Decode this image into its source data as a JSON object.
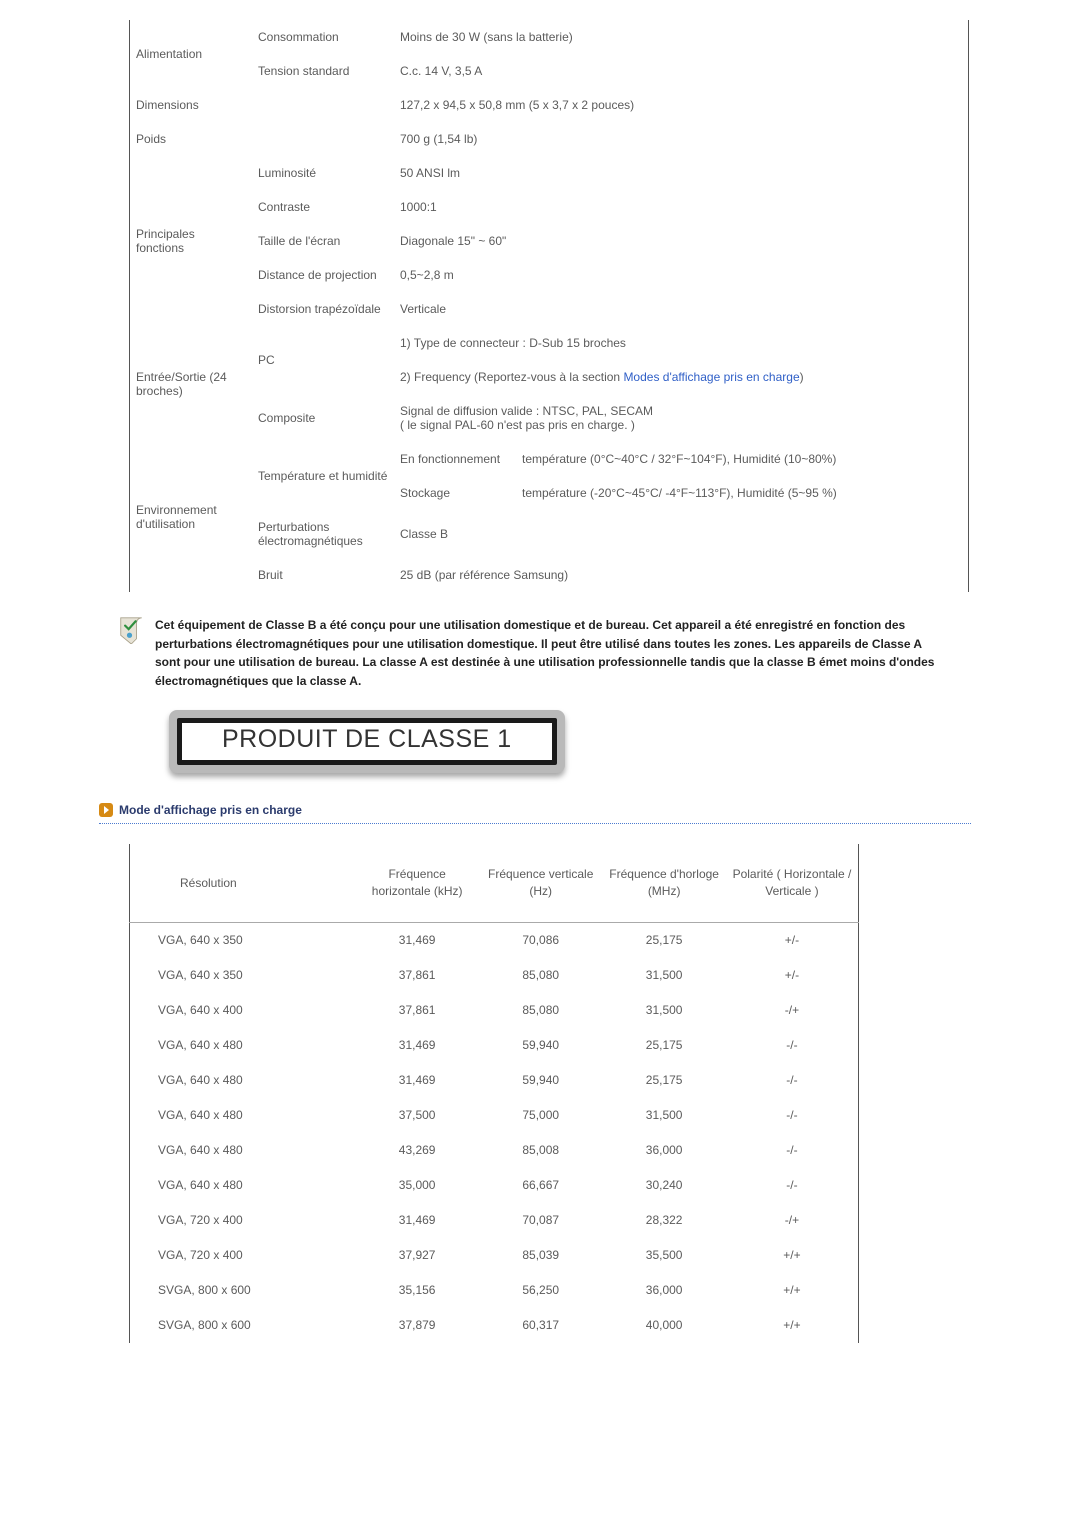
{
  "spec": {
    "rows": [
      {
        "c1": "Alimentation",
        "c1_rowspan": 2,
        "c2": "Consommation",
        "val": "Moins de 30  W (sans la batterie)"
      },
      {
        "c2": "Tension standard",
        "val": "C.c. 14 V, 3,5 A"
      },
      {
        "c1": "Dimensions",
        "c2": "",
        "val": "127,2 x 94,5 x 50,8 mm (5 x 3,7 x 2 pouces)"
      },
      {
        "c1": "Poids",
        "c2": "",
        "val": "700 g (1,54 lb)"
      },
      {
        "c1": "Principales fonctions",
        "c1_rowspan": 5,
        "c2": "Luminosité",
        "val": "50 ANSI lm"
      },
      {
        "c2": "Contraste",
        "val": "1000:1"
      },
      {
        "c2": "Taille de l'écran",
        "val": "Diagonale 15\" ~ 60\""
      },
      {
        "c2": "Distance de projection",
        "val": "0,5~2,8 m"
      },
      {
        "c2": "Distorsion trapézoïdale",
        "val": "Verticale"
      },
      {
        "c1": "Entrée/Sortie (24 broches)",
        "c1_rowspan": 3,
        "c2": "PC",
        "c2_rowspan": 2,
        "val": "1) Type de connecteur : D-Sub 15 broches"
      },
      {
        "val_prefix": "2) Frequency (Reportez-vous à la section ",
        "link": "Modes d'affichage pris en charge",
        "val_suffix": ")"
      },
      {
        "c2": "Composite",
        "val": "Signal de diffusion valide : NTSC, PAL, SECAM\n( le signal PAL-60 n'est pas pris en charge. )"
      },
      {
        "c1": "Environnement d'utilisation",
        "c1_rowspan": 4,
        "c2": "Température et humidité",
        "c2_rowspan": 2,
        "sub1": "En fonctionnement",
        "sub2": "température (0°C~40°C / 32°F~104°F), Humidité (10~80%)"
      },
      {
        "sub1": "Stockage",
        "sub2": "température (-20°C~45°C/ -4°F~113°F), Humidité (5~95 %)"
      },
      {
        "c2": "Perturbations électromagnétiques",
        "val": "Classe B"
      },
      {
        "c2": "Bruit",
        "val": "25 dB (par référence Samsung)"
      }
    ]
  },
  "note": "Cet équipement de Classe B a été conçu pour une utilisation domestique et de bureau. Cet appareil a été enregistré en fonction des perturbations électromagnétiques pour une utilisation domestique. Il peut être utilisé dans toutes les zones. Les appareils de Classe A sont pour une utilisation de bureau. La classe A est destinée à une utilisation professionnelle tandis que la classe B émet moins d'ondes électromagnétiques que la classe A.",
  "plate": "PRODUIT DE CLASSE 1",
  "modes_title": "Mode d'affichage pris en charge",
  "modes_headers": {
    "res": "Résolution",
    "h": "Fréquence horizontale (kHz)",
    "v": "Fréquence verticale (Hz)",
    "clk": "Fréquence d'horloge (MHz)",
    "pol": "Polarité ( Horizontale / Verticale )"
  },
  "chart_data": {
    "type": "table",
    "columns": [
      "Résolution",
      "Fréquence horizontale (kHz)",
      "Fréquence verticale (Hz)",
      "Fréquence d'horloge (MHz)",
      "Polarité ( Horizontale / Verticale )"
    ],
    "rows": [
      [
        "VGA, 640 x 350",
        "31,469",
        "70,086",
        "25,175",
        "+/-"
      ],
      [
        "VGA, 640 x 350",
        "37,861",
        "85,080",
        "31,500",
        "+/-"
      ],
      [
        "VGA, 640 x 400",
        "37,861",
        "85,080",
        "31,500",
        "-/+"
      ],
      [
        "VGA, 640 x 480",
        "31,469",
        "59,940",
        "25,175",
        "-/-"
      ],
      [
        "VGA, 640 x 480",
        "31,469",
        "59,940",
        "25,175",
        "-/-"
      ],
      [
        "VGA, 640 x 480",
        "37,500",
        "75,000",
        "31,500",
        "-/-"
      ],
      [
        "VGA, 640 x 480",
        "43,269",
        "85,008",
        "36,000",
        "-/-"
      ],
      [
        "VGA, 640 x 480",
        "35,000",
        "66,667",
        "30,240",
        "-/-"
      ],
      [
        "VGA, 720 x 400",
        "31,469",
        "70,087",
        "28,322",
        "-/+"
      ],
      [
        "VGA, 720 x 400",
        "37,927",
        "85,039",
        "35,500",
        "+/+"
      ],
      [
        "SVGA, 800 x 600",
        "35,156",
        "56,250",
        "36,000",
        "+/+"
      ],
      [
        "SVGA, 800 x 600",
        "37,879",
        "60,317",
        "40,000",
        "+/+"
      ]
    ]
  }
}
